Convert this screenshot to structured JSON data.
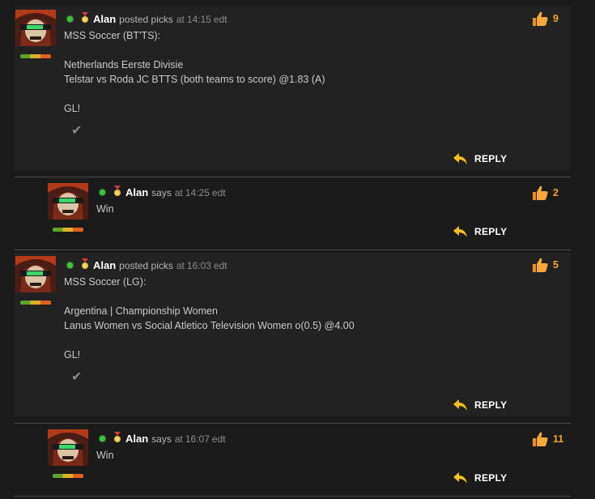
{
  "colors": {
    "accent": "#f0a030",
    "online": "#3ac43a",
    "post_bg": "#222222",
    "page_bg": "#1b1b1b"
  },
  "icons": {
    "online": "online-dot-icon",
    "badge": "medal-icon",
    "like": "thumbs-up-icon",
    "reply": "reply-arrow-icon",
    "check": "checkmark-icon"
  },
  "posts": [
    {
      "user": "Alan",
      "action": "posted picks",
      "at": "at",
      "time": "14:15",
      "tz": "edt",
      "likes": "9",
      "lines": [
        "MSS Soccer (BT'TS):",
        "",
        "Netherlands Eerste Divisie",
        "Telstar vs Roda JC BTTS (both teams to score) @1.83 (A)",
        "",
        "GL!"
      ],
      "check": "✔",
      "reply": "REPLY"
    },
    {
      "user": "Alan",
      "action": "says",
      "at": "at",
      "time": "14:25",
      "tz": "edt",
      "likes": "2",
      "lines": [
        "Win"
      ],
      "reply": "REPLY"
    },
    {
      "user": "Alan",
      "action": "posted picks",
      "at": "at",
      "time": "16:03",
      "tz": "edt",
      "likes": "5",
      "lines": [
        "MSS Soccer (LG):",
        "",
        "Argentina | Championship Women",
        "Lanus Women vs Social Atletico Television Women o(0.5) @4.00",
        "",
        "GL!"
      ],
      "check": "✔",
      "reply": "REPLY"
    },
    {
      "user": "Alan",
      "action": "says",
      "at": "at",
      "time": "16:07",
      "tz": "edt",
      "likes": "11",
      "lines": [
        "Win"
      ],
      "reply": "REPLY"
    }
  ]
}
